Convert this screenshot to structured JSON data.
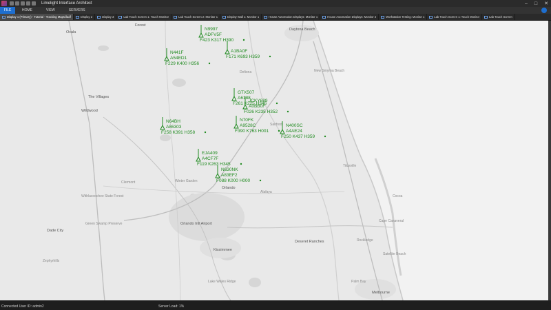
{
  "window": {
    "title": "Limelight Interface Architect",
    "controls": [
      "–",
      "□",
      "✕"
    ]
  },
  "ribbon": {
    "tabs": [
      {
        "label": "FILE"
      },
      {
        "label": "HOME"
      },
      {
        "label": "VIEW"
      },
      {
        "label": "SERVERS"
      }
    ]
  },
  "display_tabs": [
    {
      "label": "Display 1 (Primary) - Tutorial - Tracking Maps.lladf",
      "active": true
    },
    {
      "label": "Display 2",
      "active": false
    },
    {
      "label": "Display 3",
      "active": false
    },
    {
      "label": "Lab Touch Screen 1: Touch Monitor",
      "active": false
    },
    {
      "label": "Lab Touch Screen 2: Monitor 1",
      "active": false
    },
    {
      "label": "Display Wall 1: Monitor 1",
      "active": false
    },
    {
      "label": "House Automation Displays: Monitor 1",
      "active": false
    },
    {
      "label": "House Automation Displays: Monitor 2",
      "active": false
    },
    {
      "label": "Workstation Testing: Monitor 1",
      "active": false
    },
    {
      "label": "Lab Touch Screen 1: Touch Monitor",
      "active": false
    },
    {
      "label": "Lab Touch Screen",
      "active": false
    }
  ],
  "map": {
    "places": [
      {
        "name": "Forest",
        "big": true
      },
      {
        "name": "Ocala",
        "big": true
      },
      {
        "name": "Daytona Beach",
        "big": true
      },
      {
        "name": "New Smyrna Beach",
        "big": false
      },
      {
        "name": "The Villages",
        "big": true
      },
      {
        "name": "Wildwood",
        "big": true
      },
      {
        "name": "Deltona",
        "big": false
      },
      {
        "name": "Sanford",
        "big": false
      },
      {
        "name": "Orlando",
        "big": true
      },
      {
        "name": "Kissimmee",
        "big": true
      },
      {
        "name": "Winter Garden",
        "big": false
      },
      {
        "name": "Alafaya",
        "big": false
      },
      {
        "name": "Titusville",
        "big": false
      },
      {
        "name": "Cocoa",
        "big": false
      },
      {
        "name": "Cape Canaveral",
        "big": false
      },
      {
        "name": "Rockledge",
        "big": false
      },
      {
        "name": "Melbourne",
        "big": true
      },
      {
        "name": "Satellite Beach",
        "big": false
      },
      {
        "name": "Palm Bay",
        "big": false
      },
      {
        "name": "Dade City",
        "big": true
      },
      {
        "name": "Zephyrhills",
        "big": false
      },
      {
        "name": "Clermont",
        "big": false
      },
      {
        "name": "Deseret Ranches",
        "big": true
      },
      {
        "name": "Orlando Intl Airport",
        "big": true
      },
      {
        "name": "Withlacoochee State Forest",
        "big": false
      },
      {
        "name": "Green Swamp Preserve",
        "big": false
      },
      {
        "name": "Lake Wales Ridge",
        "big": false
      }
    ],
    "tracks": [
      {
        "id": "N9997",
        "code": "ADFV5F",
        "info": "F423  K317  H390"
      },
      {
        "id": "",
        "code": "A1BA0F",
        "info": "F171  K693  H359"
      },
      {
        "id": "N441F",
        "code": "A54ED1",
        "info": "F229  K400  H356"
      },
      {
        "id": "GTX507",
        "code": "A6188",
        "info": "F261  K225  H346"
      },
      {
        "id": "JCKY689",
        "code": "A0BB0F",
        "info": "F026  K235  H352"
      },
      {
        "id": "N70FK",
        "code": "A9528C",
        "info": "F390  K763  H001"
      },
      {
        "id": "N64BH",
        "code": "A86303",
        "info": "F258  K391  H358"
      },
      {
        "id": "N400SC",
        "code": "A4AE24",
        "info": "F250  K437  H359"
      },
      {
        "id": "EJA409",
        "code": "A4CF7F",
        "info": "F119  K263  H345"
      },
      {
        "id": "N630NK",
        "code": "A83EF2",
        "info": "F088  K000  H000"
      }
    ]
  },
  "status": {
    "connection": "Connected  User ID: admin2",
    "server_load": "Server Load: 1%"
  },
  "colors": {
    "track": "#1f8a1f",
    "accent": "#1e6fd0"
  }
}
